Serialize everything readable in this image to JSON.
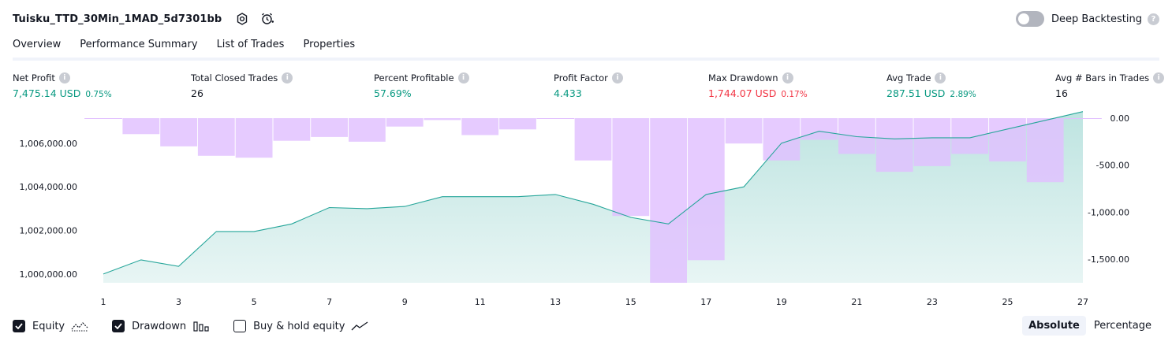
{
  "header": {
    "strategy_name": "Tuisku_TTD_30Min_1MAD_5d7301bb",
    "deep_backtesting_label": "Deep Backtesting",
    "deep_backtesting_on": false
  },
  "tabs": [
    {
      "label": "Overview",
      "active": true
    },
    {
      "label": "Performance Summary",
      "active": false
    },
    {
      "label": "List of Trades",
      "active": false
    },
    {
      "label": "Properties",
      "active": false
    }
  ],
  "metrics": [
    {
      "label": "Net Profit",
      "value": "7,475.14 USD",
      "pct": "0.75%",
      "color": "green"
    },
    {
      "label": "Total Closed Trades",
      "value": "26",
      "pct": "",
      "color": "dark"
    },
    {
      "label": "Percent Profitable",
      "value": "57.69%",
      "pct": "",
      "color": "green"
    },
    {
      "label": "Profit Factor",
      "value": "4.433",
      "pct": "",
      "color": "green"
    },
    {
      "label": "Max Drawdown",
      "value": "1,744.07 USD",
      "pct": "0.17%",
      "color": "red"
    },
    {
      "label": "Avg Trade",
      "value": "287.51 USD",
      "pct": "2.89%",
      "color": "green"
    },
    {
      "label": "Avg # Bars in Trades",
      "value": "16",
      "pct": "",
      "color": "dark"
    }
  ],
  "colors": {
    "equity_line": "#26a69a",
    "equity_fill": "#b2dfdb",
    "drawdown_bar": "#e1bfff",
    "green": "#089981",
    "red": "#f23645"
  },
  "legend": {
    "equity_label": "Equity",
    "equity_checked": true,
    "drawdown_label": "Drawdown",
    "drawdown_checked": true,
    "buyhold_label": "Buy & hold equity",
    "buyhold_checked": false
  },
  "scale": {
    "absolute_label": "Absolute",
    "percentage_label": "Percentage",
    "selected": "Absolute"
  },
  "chart_data": {
    "type": "line",
    "x": [
      1,
      2,
      3,
      4,
      5,
      6,
      7,
      8,
      9,
      10,
      11,
      12,
      13,
      14,
      15,
      16,
      17,
      18,
      19,
      20,
      21,
      22,
      23,
      24,
      25,
      26,
      27
    ],
    "x_tick_labels": [
      "1",
      "3",
      "5",
      "7",
      "9",
      "11",
      "13",
      "15",
      "17",
      "19",
      "21",
      "23",
      "25",
      "27"
    ],
    "left_axis": {
      "ylim": [
        999600,
        1007150
      ],
      "ticks": [
        1000000,
        1002000,
        1004000,
        1006000
      ],
      "tick_labels": [
        "1,000,000.00",
        "1,002,000.00",
        "1,004,000.00",
        "1,006,000.00"
      ]
    },
    "right_axis": {
      "ylim": [
        -1750,
        0
      ],
      "ticks": [
        0,
        -500,
        -1000,
        -1500
      ],
      "tick_labels": [
        "0.00",
        "-500.00",
        "-1,000.00",
        "-1,500.00"
      ]
    },
    "series": [
      {
        "name": "Equity",
        "axis": "left",
        "values": [
          1000000,
          1000650,
          1000350,
          1001950,
          1001950,
          1002300,
          1003050,
          1003000,
          1003100,
          1003550,
          1003550,
          1003550,
          1003650,
          1003200,
          1002600,
          1002300,
          1003650,
          1004000,
          1006000,
          1006550,
          1006300,
          1006200,
          1006250,
          1006250,
          1006650,
          1007050,
          1007450
        ]
      },
      {
        "name": "Drawdown",
        "axis": "right",
        "type": "bar",
        "values": [
          0,
          -170,
          -300,
          -400,
          -420,
          -240,
          -200,
          -250,
          -90,
          -20,
          -180,
          -120,
          0,
          -450,
          -1040,
          -1750,
          -1510,
          -270,
          -450,
          -230,
          -380,
          -570,
          -510,
          -380,
          -460,
          -680,
          0
        ]
      }
    ]
  }
}
